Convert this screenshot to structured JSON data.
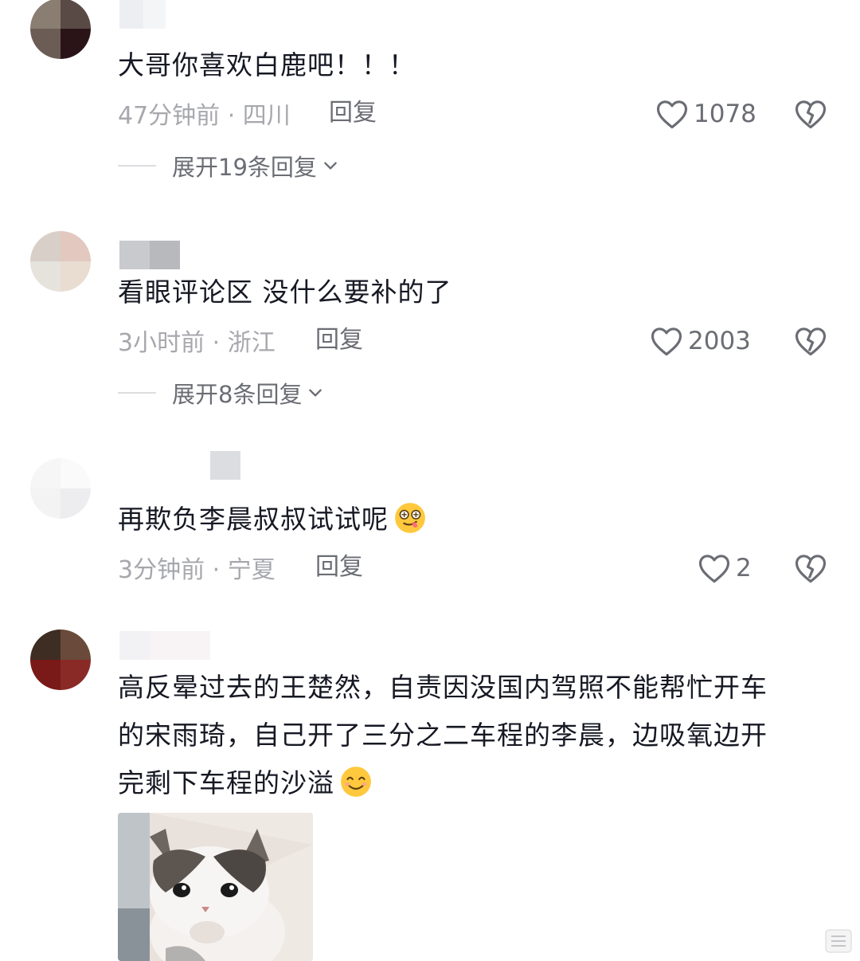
{
  "comments": [
    {
      "text": "大哥你喜欢白鹿吧！！！",
      "time_location": "47分钟前 · 四川",
      "reply_label": "回复",
      "likes": "1078",
      "expand_label": "展开19条回复"
    },
    {
      "text": "看眼评论区 没什么要补的了",
      "time_location": "3小时前 · 浙江",
      "reply_label": "回复",
      "likes": "2003",
      "expand_label": "展开8条回复"
    },
    {
      "text": "再欺负李晨叔叔试试呢",
      "time_location": "3分钟前 · 宁夏",
      "reply_label": "回复",
      "likes": "2",
      "emoji": "drooling-face"
    },
    {
      "text_lines": [
        "高反晕过去的王楚然，自责因没国内驾照不能帮忙开车",
        "的宋雨琦，自己开了三分之二车程的李晨，边吸氧边开",
        "完剩下车程的沙溢"
      ],
      "emoji": "smiling-face",
      "image": "kitten-photo"
    }
  ],
  "icons": {
    "like": "heart-outline-icon",
    "dislike": "broken-heart-icon",
    "expand": "chevron-down-icon"
  },
  "colors": {
    "primary_text": "#161823",
    "meta_text": "#a7a8ad",
    "action_text": "#6b6d74"
  }
}
